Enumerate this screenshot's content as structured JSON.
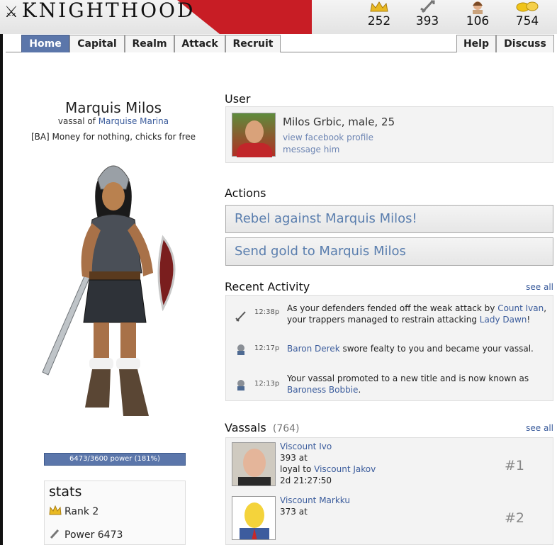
{
  "header": {
    "logo": "KNIGHTHOOD",
    "stats": [
      {
        "icon": "crown-icon",
        "value": "252"
      },
      {
        "icon": "sword-icon",
        "value": "393"
      },
      {
        "icon": "portrait-icon",
        "value": "106"
      },
      {
        "icon": "gold-coins-icon",
        "value": "754"
      }
    ]
  },
  "nav": {
    "tabs": [
      "Home",
      "Capital",
      "Realm",
      "Attack",
      "Recruit"
    ],
    "right_tabs": [
      "Help",
      "Discuss"
    ],
    "active": "Home"
  },
  "profile": {
    "name": "Marquis Milos",
    "vassal_prefix": "vassal of",
    "liege": "Marquise Marina",
    "motto": "[BA] Money for nothing, chicks for free",
    "power_text": "6473/3600 power (181%)",
    "power_percent": 181
  },
  "stats": {
    "title": "stats",
    "rank": "Rank 2",
    "power": "Power 6473"
  },
  "user": {
    "title": "User",
    "name_line": "Milos Grbic, male, 25",
    "link_facebook": "view facebook profile",
    "link_message": "message him"
  },
  "actions": {
    "title": "Actions",
    "rebel": "Rebel against Marquis Milos!",
    "send_gold": "Send gold to Marquis Milos"
  },
  "activity": {
    "title": "Recent Activity",
    "see_all": "see all",
    "items": [
      {
        "time": "12:38p",
        "pre": "As your defenders fended off the weak attack by ",
        "link1": "Count Ivan",
        "mid": ", your trappers managed to restrain attacking ",
        "link2": "Lady Dawn",
        "post": "!"
      },
      {
        "time": "12:17p",
        "link1": "Baron Derek",
        "post": " swore fealty to you and became your vassal."
      },
      {
        "time": "12:13p",
        "pre": "Your vassal promoted to a new title and is now known as ",
        "link1": "Baroness Bobbie",
        "post": "."
      }
    ]
  },
  "vassals": {
    "title": "Vassals",
    "count": "(764)",
    "see_all": "see all",
    "items": [
      {
        "name": "Viscount Ivo",
        "line1": "393 at",
        "loyal_prefix": "loyal to ",
        "loyal_link": "Viscount Jakov",
        "time": "2d 21:27:50",
        "rank": "#1"
      },
      {
        "name": "Viscount Markku",
        "line1": "373 at",
        "rank": "#2"
      }
    ]
  }
}
